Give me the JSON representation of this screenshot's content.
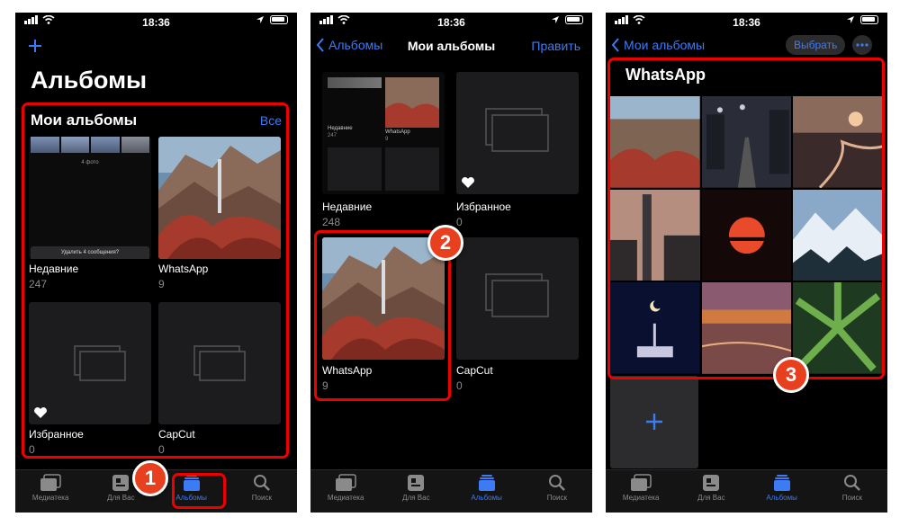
{
  "status": {
    "time": "18:36"
  },
  "colors": {
    "accent": "#3d7bf5",
    "highlight": "#e00000",
    "badge": "#e8401e"
  },
  "tabs": [
    "Медиатека",
    "Для Вас",
    "Альбомы",
    "Поиск"
  ],
  "screen1": {
    "add_icon": "plus-icon",
    "title": "Альбомы",
    "section_title": "Мои альбомы",
    "see_all": "Все",
    "albums": [
      {
        "name": "Недавние",
        "count": "247"
      },
      {
        "name": "WhatsApp",
        "count": "9"
      },
      {
        "name": "Избранное",
        "count": "0"
      },
      {
        "name": "CapCut",
        "count": "0"
      }
    ],
    "recent_thumb": {
      "caption_top": "4 фото",
      "caption_bottom": "Удалить 4 сообщения?"
    },
    "badge": "1"
  },
  "screen2": {
    "back": "Альбомы",
    "title": "Мои альбомы",
    "edit": "Править",
    "albums": [
      {
        "name": "Недавние",
        "count": "248"
      },
      {
        "name": "Избранное",
        "count": "0"
      },
      {
        "name": "WhatsApp",
        "count": "9"
      },
      {
        "name": "CapCut",
        "count": "0"
      }
    ],
    "recent_mini_labels": [
      "Недавние",
      "WhatsApp"
    ],
    "recent_mini_counts": [
      "247",
      "9"
    ],
    "badge": "2"
  },
  "screen3": {
    "back": "Мои альбомы",
    "select": "Выбрать",
    "more_icon": "ellipsis-icon",
    "album_title": "WhatsApp",
    "add_icon": "plus-icon",
    "badge": "3"
  }
}
